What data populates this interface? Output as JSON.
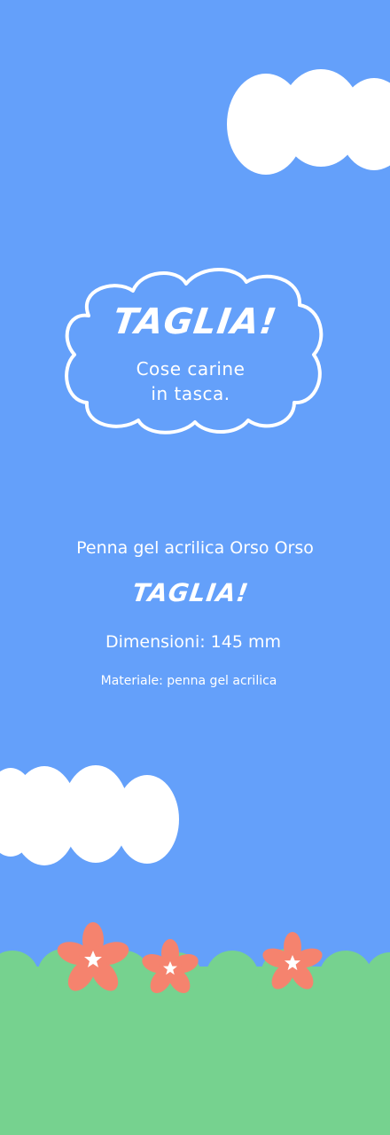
{
  "badge": {
    "title": "TAGLIA!",
    "subtitle_line1": "Cose carine",
    "subtitle_line2": "in tasca."
  },
  "product": {
    "name": "Penna gel acrilica Orso Orso",
    "brand": "TAGLIA!",
    "dimensions": "Dimensioni: 145 mm",
    "material": "Materiale: penna gel acrilica"
  },
  "colors": {
    "sky": "#64a0fa",
    "cloud": "#ffffff",
    "grass": "#76d28f",
    "flower": "#f5836e",
    "flower_center": "#ffffff"
  }
}
